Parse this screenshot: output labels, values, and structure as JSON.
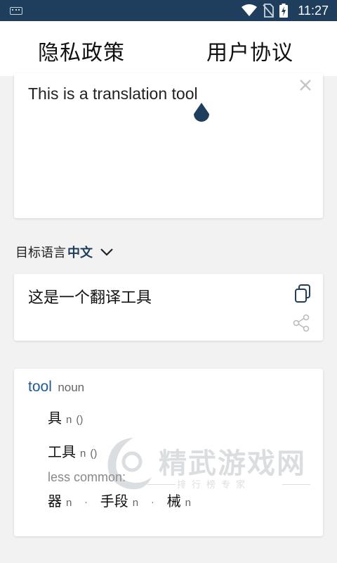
{
  "status_bar": {
    "time": "11:27",
    "icons": [
      "keyboard-icon",
      "wifi-icon",
      "no-sim-icon",
      "battery-charging-icon"
    ]
  },
  "tabs": {
    "privacy": "隐私政策",
    "agreement": "用户协议"
  },
  "input": {
    "text": "This is a translation tool",
    "clear_icon": "close-icon"
  },
  "target_language": {
    "label": "目标语言",
    "value": "中文",
    "dropdown_icon": "chevron-down-icon"
  },
  "result": {
    "text": "这是一个翻译工具",
    "copy_icon": "copy-icon",
    "share_icon": "share-icon"
  },
  "dictionary": {
    "word": "tool",
    "part_of_speech": "noun",
    "entries": [
      {
        "term": "具",
        "pos": "n",
        "extra": "()"
      },
      {
        "term": "工具",
        "pos": "n",
        "extra": "()"
      }
    ],
    "less_common_label": "less common:",
    "less_common": [
      {
        "term": "器",
        "pos": "n"
      },
      {
        "term": "手段",
        "pos": "n"
      },
      {
        "term": "械",
        "pos": "n"
      }
    ]
  },
  "watermark": {
    "title": "精武游戏网",
    "subtitle": "排行榜专家"
  },
  "colors": {
    "status_bar": "#1f3d5c",
    "accent": "#1f5b8f",
    "background": "#f2f2f2"
  }
}
